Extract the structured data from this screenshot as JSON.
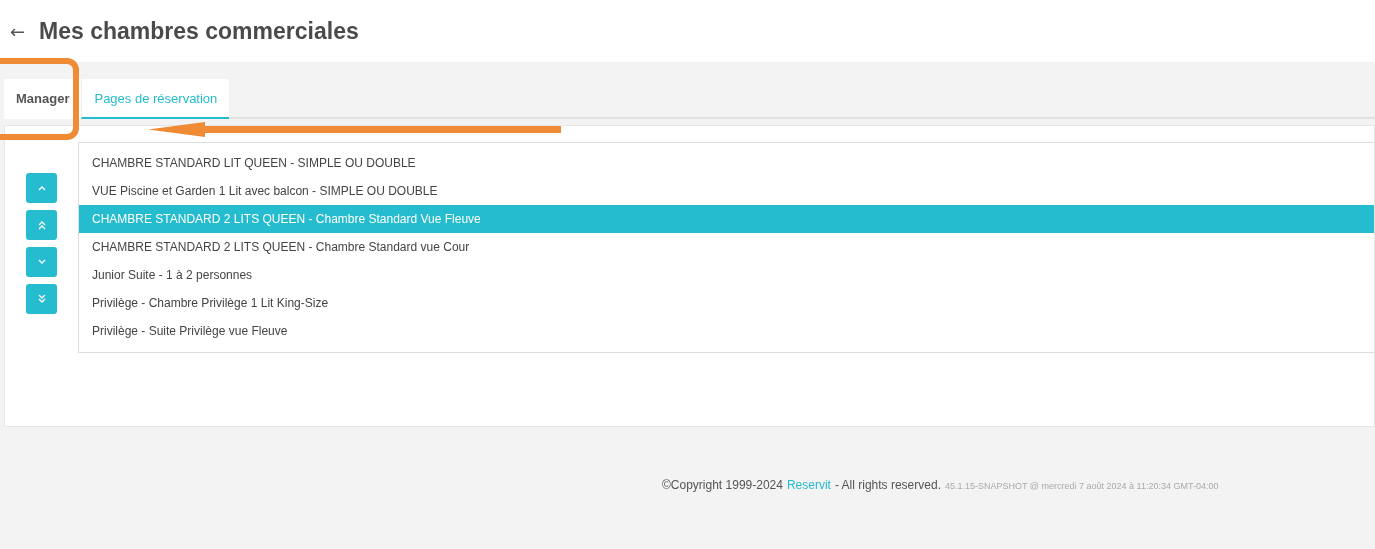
{
  "header": {
    "back": "←",
    "title": "Mes chambres commerciales"
  },
  "tabs": [
    {
      "label": "Manager",
      "selected": false
    },
    {
      "label": "Pages de réservation",
      "selected": true
    }
  ],
  "move_buttons": [
    {
      "kind": "up"
    },
    {
      "kind": "top"
    },
    {
      "kind": "down"
    },
    {
      "kind": "bottom"
    }
  ],
  "rooms": [
    {
      "label": "CHAMBRE STANDARD LIT QUEEN - SIMPLE OU DOUBLE",
      "selected": false
    },
    {
      "label": "VUE Piscine et Garden 1 Lit avec balcon - SIMPLE OU DOUBLE",
      "selected": false
    },
    {
      "label": "CHAMBRE STANDARD 2 LITS QUEEN - Chambre Standard Vue Fleuve",
      "selected": true
    },
    {
      "label": "CHAMBRE STANDARD 2 LITS QUEEN - Chambre Standard vue Cour",
      "selected": false
    },
    {
      "label": "Junior Suite - 1 à 2 personnes",
      "selected": false
    },
    {
      "label": "Privilège - Chambre Privilège 1 Lit King-Size",
      "selected": false
    },
    {
      "label": "Privilège - Suite Privilège vue Fleuve",
      "selected": false
    }
  ],
  "footer": {
    "copyright": "©Copyright 1999-2024",
    "link": "Reservit",
    "rights": "- All rights reserved.",
    "version": "45.1.15-SNAPSHOT @ mercredi 7 août 2024 à 11:20:34 GMT-04:00"
  }
}
